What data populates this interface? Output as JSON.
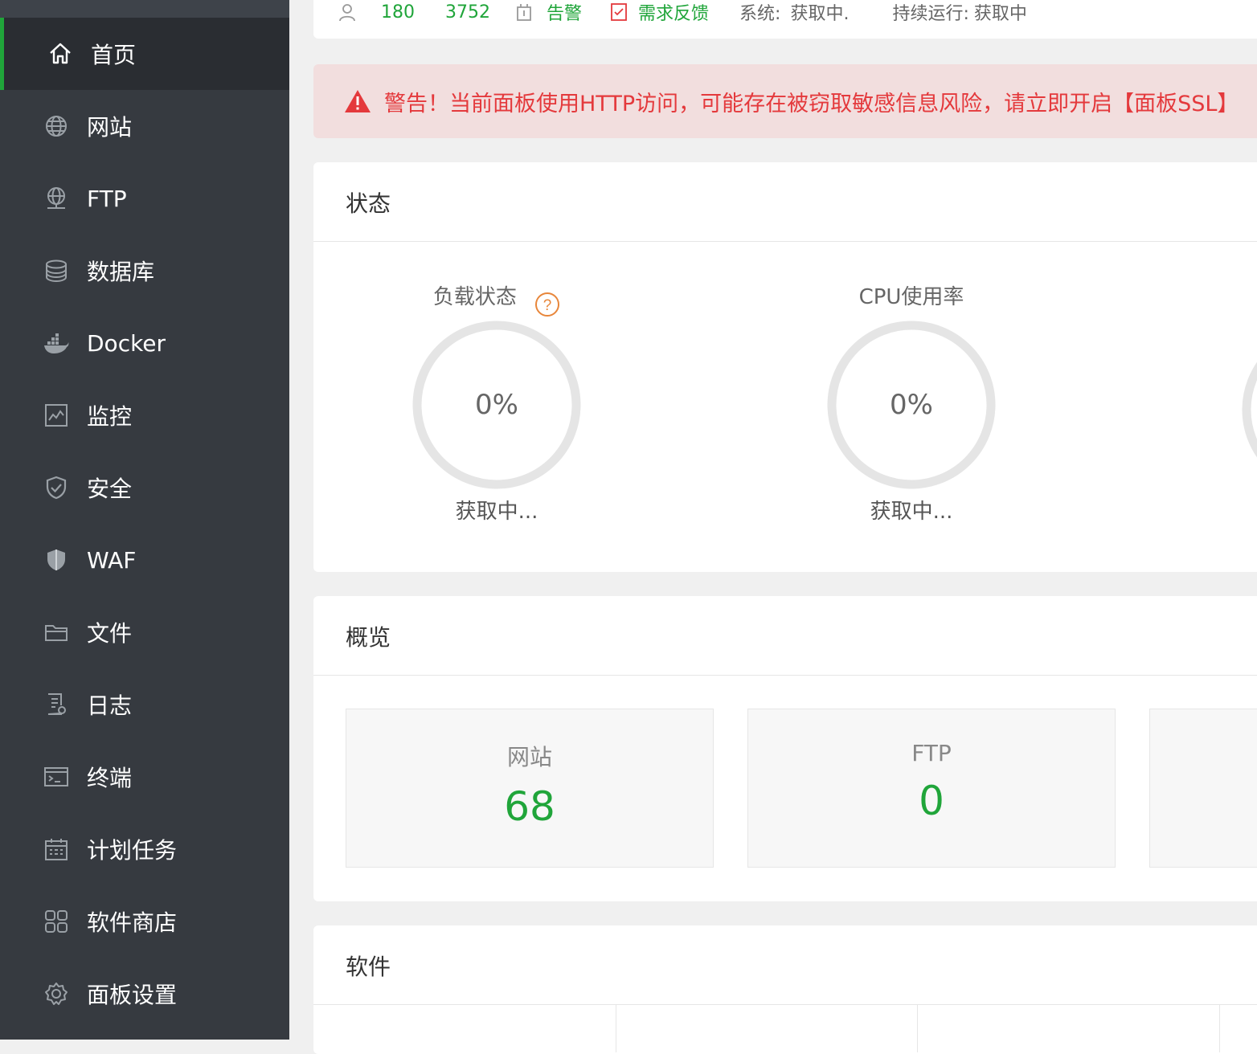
{
  "sidebar": {
    "items": [
      {
        "label": "首页",
        "icon": "home-icon",
        "active": true
      },
      {
        "label": "网站",
        "icon": "globe-icon"
      },
      {
        "label": "FTP",
        "icon": "ftp-icon"
      },
      {
        "label": "数据库",
        "icon": "database-icon"
      },
      {
        "label": "Docker",
        "icon": "docker-icon"
      },
      {
        "label": "监控",
        "icon": "monitor-icon"
      },
      {
        "label": "安全",
        "icon": "shield-icon"
      },
      {
        "label": "WAF",
        "icon": "waf-icon"
      },
      {
        "label": "文件",
        "icon": "folder-icon"
      },
      {
        "label": "日志",
        "icon": "log-icon"
      },
      {
        "label": "终端",
        "icon": "terminal-icon"
      },
      {
        "label": "计划任务",
        "icon": "calendar-icon"
      },
      {
        "label": "软件商店",
        "icon": "grid-icon"
      },
      {
        "label": "面板设置",
        "icon": "gear-icon"
      }
    ]
  },
  "topbar": {
    "user_count": "180",
    "id_count": "3752",
    "alarm_label": "告警",
    "feedback_label": "需求反馈",
    "system_label": "系统:",
    "system_value": "获取中.",
    "uptime_label": "持续运行:",
    "uptime_value": "获取中"
  },
  "alert": {
    "text": "警告！当前面板使用HTTP访问，可能存在被窃取敏感信息风险，请立即开启【面板SSL】"
  },
  "status": {
    "title": "状态",
    "gauges": [
      {
        "title": "负载状态",
        "value": "0%",
        "sub": "获取中...",
        "percent": 0
      },
      {
        "title": "CPU使用率",
        "value": "0%",
        "sub": "获取中...",
        "percent": 0
      }
    ]
  },
  "overview": {
    "title": "概览",
    "boxes": [
      {
        "label": "网站",
        "value": "68"
      },
      {
        "label": "FTP",
        "value": "0"
      }
    ]
  },
  "software": {
    "title": "软件"
  },
  "colors": {
    "accent": "#20a53a",
    "sidebar": "#363a40",
    "alert_text": "#e4393c",
    "help": "#e8863a"
  }
}
